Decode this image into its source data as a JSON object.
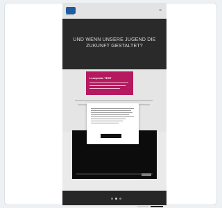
{
  "hero": {
    "title": "UND WENN UNSERE JUGEND DIE ZUKUNFT GESTALTET?"
  },
  "promo": {
    "title": "Leseprobe TEST"
  },
  "colors": {
    "accent": "#b5195f",
    "brand": "#1f63a8",
    "dark": "#2d2d2d"
  },
  "icons": {
    "menu": "close-icon"
  }
}
